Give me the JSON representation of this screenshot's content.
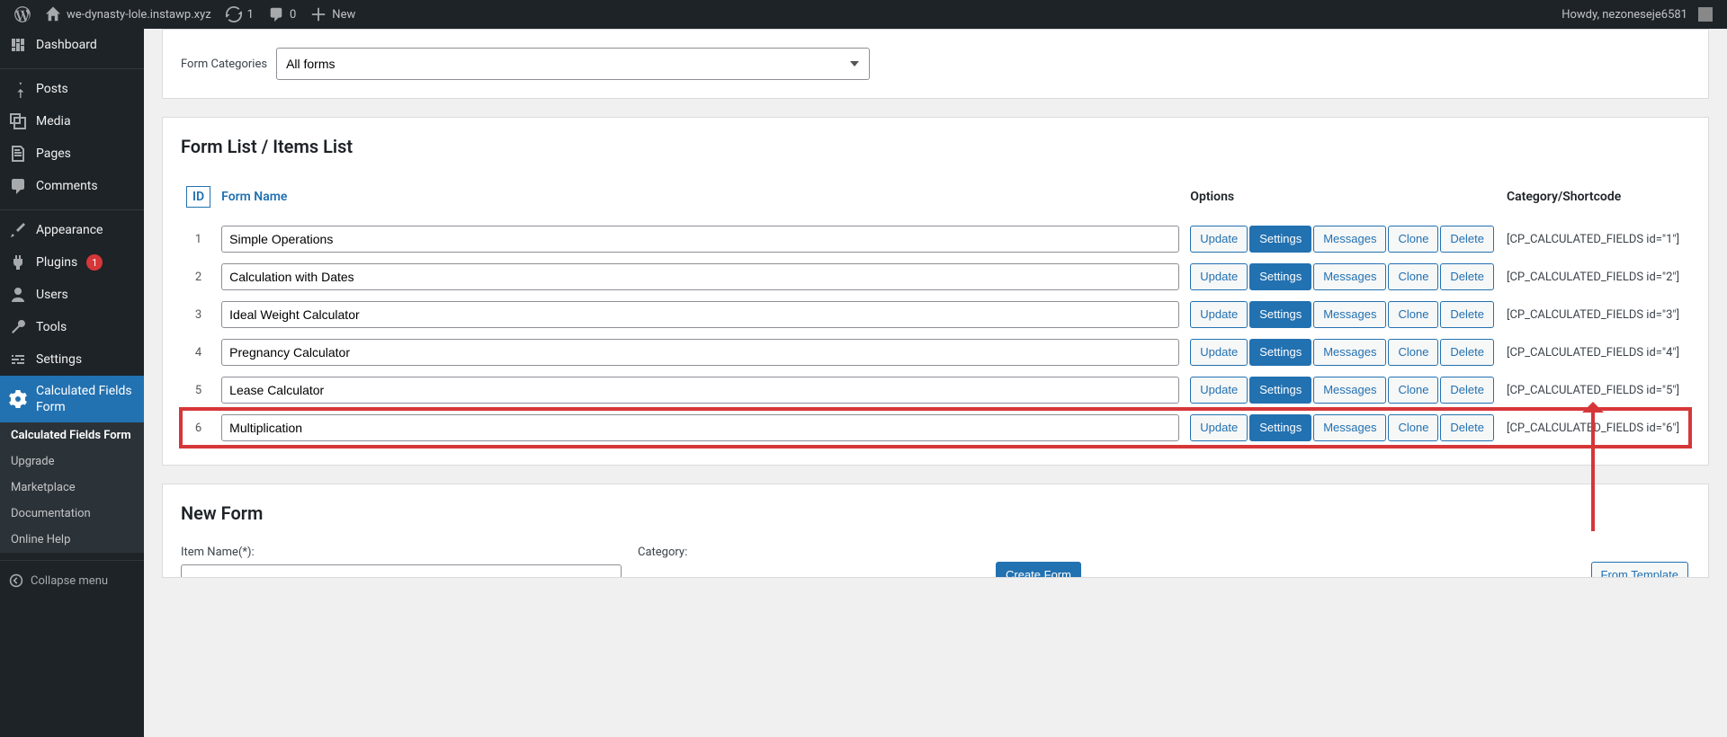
{
  "adminbar": {
    "site_name": "we-dynasty-lole.instawp.xyz",
    "updates_count": "1",
    "comments_count": "0",
    "new_label": "New",
    "howdy": "Howdy, nezoneseje6581"
  },
  "sidebar": {
    "dashboard": "Dashboard",
    "posts": "Posts",
    "media": "Media",
    "pages": "Pages",
    "comments": "Comments",
    "appearance": "Appearance",
    "plugins": "Plugins",
    "plugins_badge": "1",
    "users": "Users",
    "tools": "Tools",
    "settings": "Settings",
    "cff": "Calculated Fields Form",
    "sub_cff": "Calculated Fields Form",
    "sub_upgrade": "Upgrade",
    "sub_marketplace": "Marketplace",
    "sub_documentation": "Documentation",
    "sub_help": "Online Help",
    "collapse": "Collapse menu"
  },
  "categories": {
    "label": "Form Categories",
    "selected": "All forms"
  },
  "list": {
    "title": "Form List / Items List",
    "header_id": "ID",
    "header_name": "Form Name",
    "header_options": "Options",
    "header_shortcode": "Category/Shortcode",
    "btn_update": "Update",
    "btn_settings": "Settings",
    "btn_messages": "Messages",
    "btn_clone": "Clone",
    "btn_delete": "Delete",
    "rows": [
      {
        "id": "1",
        "name": "Simple Operations",
        "shortcode": "[CP_CALCULATED_FIELDS id=\"1\"]"
      },
      {
        "id": "2",
        "name": "Calculation with Dates",
        "shortcode": "[CP_CALCULATED_FIELDS id=\"2\"]"
      },
      {
        "id": "3",
        "name": "Ideal Weight Calculator",
        "shortcode": "[CP_CALCULATED_FIELDS id=\"3\"]"
      },
      {
        "id": "4",
        "name": "Pregnancy Calculator",
        "shortcode": "[CP_CALCULATED_FIELDS id=\"4\"]"
      },
      {
        "id": "5",
        "name": "Lease Calculator",
        "shortcode": "[CP_CALCULATED_FIELDS id=\"5\"]"
      },
      {
        "id": "6",
        "name": "Multiplication",
        "shortcode": "[CP_CALCULATED_FIELDS id=\"6\"]"
      }
    ]
  },
  "new_form": {
    "title": "New Form",
    "item_name_label": "Item Name(*):",
    "category_label": "Category:",
    "create_button": "Create Form",
    "template_button": "From Template"
  }
}
